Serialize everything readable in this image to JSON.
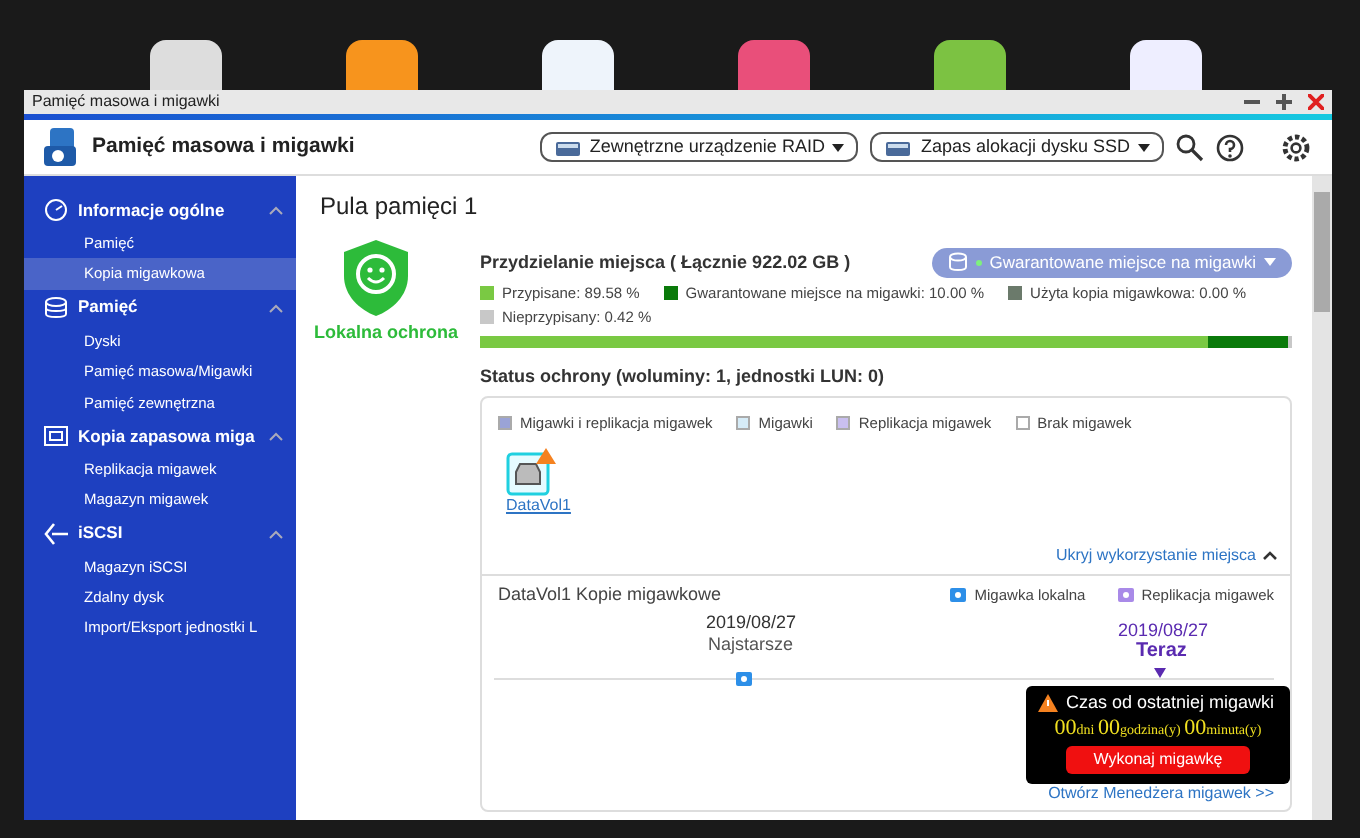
{
  "window": {
    "title": "Pamięć masowa i migawki"
  },
  "header": {
    "app_title": "Pamięć masowa i migawki",
    "dropdowns": [
      "Zewnętrzne urządzenie RAID",
      "Zapas alokacji dysku SSD"
    ]
  },
  "sidebar": {
    "groups": [
      {
        "title": "Informacje ogólne",
        "expanded": true,
        "items": [
          {
            "label": "Pamięć",
            "selected": false
          },
          {
            "label": "Kopia migawkowa",
            "selected": true
          }
        ]
      },
      {
        "title": "Pamięć",
        "expanded": true,
        "items": [
          {
            "label": "Dyski",
            "selected": false
          },
          {
            "label": "Pamięć masowa/Migawki",
            "selected": false
          },
          {
            "label": "Pamięć zewnętrzna",
            "selected": false
          }
        ]
      },
      {
        "title": "Kopia zapasowa miga",
        "expanded": true,
        "items": [
          {
            "label": "Replikacja migawek",
            "selected": false
          },
          {
            "label": "Magazyn migawek",
            "selected": false
          }
        ]
      },
      {
        "title": "iSCSI",
        "expanded": true,
        "items": [
          {
            "label": "Magazyn iSCSI",
            "selected": false
          },
          {
            "label": "Zdalny dysk",
            "selected": false
          },
          {
            "label": "Import/Eksport jednostki L",
            "selected": false
          }
        ]
      }
    ]
  },
  "pool": {
    "title": "Pula pamięci 1",
    "protection_label": "Lokalna ochrona",
    "allocation": {
      "title": "Przydzielanie miejsca ( Łącznie 922.02 GB )",
      "mode_button": "Gwarantowane miejsce na migawki",
      "segments": [
        {
          "label": "Przypisane: 89.58 %",
          "color": "#7ac943",
          "level": 0.8958
        },
        {
          "label": "Gwarantowane miejsce na migawki: 10.00 %",
          "color": "#0a7a0a",
          "level": 0.1
        },
        {
          "label": "Użyta kopia migawkowa: 0.00 %",
          "color": "#6b7a6b",
          "level": 0.0
        },
        {
          "label": "Nieprzypisany: 0.42 %",
          "color": "#c8c8c8",
          "level": 0.0042
        }
      ]
    },
    "status": {
      "title": "Status ochrony (woluminy: 1, jednostki LUN: 0)",
      "legend": [
        {
          "label": "Migawki i replikacja migawek",
          "color": "#9aa3d6"
        },
        {
          "label": "Migawki",
          "color": "#d6ecf8"
        },
        {
          "label": "Replikacja migawek",
          "color": "#c9bff0"
        },
        {
          "label": "Brak migawek",
          "color": "#ffffff"
        }
      ],
      "volumes": [
        {
          "name": "DataVol1",
          "warning": true
        }
      ],
      "hide_link": "Ukryj wykorzystanie miejsca"
    },
    "snapshots": {
      "title": "DataVol1 Kopie migawkowe",
      "legend": [
        "Migawka lokalna",
        "Replikacja migawek"
      ],
      "oldest": {
        "date": "2019/08/27",
        "label": "Najstarsze"
      },
      "latest": {
        "date": "2019/08/27",
        "label": "Teraz"
      },
      "tooltip": {
        "title": "Czas od ostatniej migawki",
        "countdown": [
          {
            "value": "00",
            "unit": "dni"
          },
          {
            "value": "00",
            "unit": "godzina(y)"
          },
          {
            "value": "00",
            "unit": "minuta(y)"
          }
        ],
        "button": "Wykonaj migawkę"
      },
      "manager_link": "Otwórz Menedżera migawek >>"
    }
  }
}
